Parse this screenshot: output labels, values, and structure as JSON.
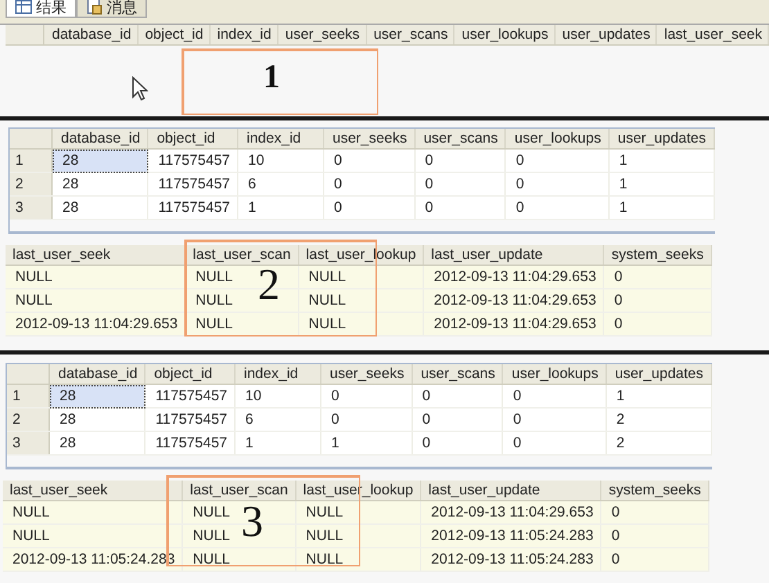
{
  "tabs": [
    {
      "label": "结果",
      "selected": true
    },
    {
      "label": "消息",
      "selected": false
    }
  ],
  "panels": [
    {
      "annotation": "1",
      "grids": [
        {
          "kind": "numbered",
          "columns": [
            "database_id",
            "object_id",
            "index_id",
            "user_seeks",
            "user_scans",
            "user_lookups",
            "user_updates",
            "last_user_seek"
          ]
        }
      ]
    },
    {
      "annotation": "2",
      "grids": [
        {
          "kind": "numbered",
          "columns": [
            "database_id",
            "object_id",
            "index_id",
            "user_seeks",
            "user_scans",
            "user_lookups",
            "user_updates"
          ],
          "rows": [
            {
              "number": "1",
              "current": true,
              "cells": [
                "28",
                "117575457",
                "10",
                "0",
                "0",
                "0",
                "1"
              ]
            },
            {
              "number": "2",
              "current": false,
              "cells": [
                "28",
                "117575457",
                "6",
                "0",
                "0",
                "0",
                "1"
              ]
            },
            {
              "number": "3",
              "current": false,
              "cells": [
                "28",
                "117575457",
                "1",
                "0",
                "0",
                "0",
                "1"
              ]
            }
          ]
        },
        {
          "kind": "plain",
          "columns": [
            "last_user_seek",
            "last_user_scan",
            "last_user_lookup",
            "last_user_update",
            "system_seeks"
          ],
          "rows": [
            {
              "cells": [
                "NULL",
                "NULL",
                "NULL",
                "2012-09-13 11:04:29.653",
                "0"
              ]
            },
            {
              "cells": [
                "NULL",
                "NULL",
                "NULL",
                "2012-09-13 11:04:29.653",
                "0"
              ]
            },
            {
              "cells": [
                "2012-09-13 11:04:29.653",
                "NULL",
                "NULL",
                "2012-09-13 11:04:29.653",
                "0"
              ]
            }
          ]
        }
      ]
    },
    {
      "annotation": "3",
      "grids": [
        {
          "kind": "numbered",
          "columns": [
            "database_id",
            "object_id",
            "index_id",
            "user_seeks",
            "user_scans",
            "user_lookups",
            "user_updates"
          ],
          "rows": [
            {
              "number": "1",
              "current": true,
              "cells": [
                "28",
                "117575457",
                "10",
                "0",
                "0",
                "0",
                "1"
              ]
            },
            {
              "number": "2",
              "current": false,
              "cells": [
                "28",
                "117575457",
                "6",
                "0",
                "0",
                "0",
                "2"
              ]
            },
            {
              "number": "3",
              "current": false,
              "cells": [
                "28",
                "117575457",
                "1",
                "1",
                "0",
                "0",
                "2"
              ]
            }
          ]
        },
        {
          "kind": "plain",
          "columns": [
            "last_user_seek",
            "last_user_scan",
            "last_user_lookup",
            "last_user_update",
            "system_seeks"
          ],
          "rows": [
            {
              "cells": [
                "NULL",
                "NULL",
                "NULL",
                "2012-09-13 11:04:29.653",
                "0"
              ]
            },
            {
              "cells": [
                "NULL",
                "NULL",
                "NULL",
                "2012-09-13 11:05:24.283",
                "0"
              ]
            },
            {
              "cells": [
                "2012-09-13 11:05:24.283",
                "NULL",
                "NULL",
                "2012-09-13 11:05:24.283",
                "0"
              ]
            }
          ]
        }
      ]
    }
  ]
}
